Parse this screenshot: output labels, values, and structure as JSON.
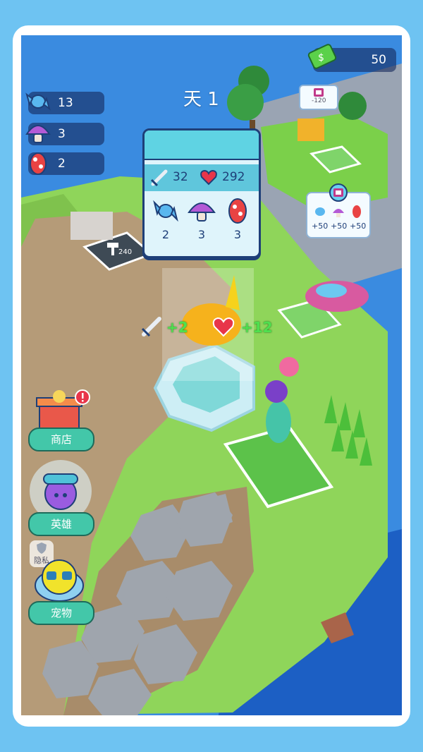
{
  "hud": {
    "money_value": "50",
    "resources": [
      {
        "name": "candy",
        "value": "13"
      },
      {
        "name": "mushroom",
        "value": "3"
      },
      {
        "name": "egg",
        "value": "2"
      }
    ],
    "day_label": "天 1"
  },
  "stats_card": {
    "attack": "32",
    "health": "292",
    "items": [
      {
        "name": "candy",
        "count": "2"
      },
      {
        "name": "mushroom",
        "count": "3"
      },
      {
        "name": "egg",
        "count": "3"
      }
    ]
  },
  "ad_bubble": {
    "rewards": [
      "+50",
      "+50",
      "+50"
    ]
  },
  "money_popup": "-120",
  "build_cost": "240",
  "floating": {
    "attack_gain": "+2",
    "health_gain": "+12"
  },
  "side_menu": {
    "shop": "商店",
    "hero": "英雄",
    "pet": "宠物",
    "privacy": "隐私"
  },
  "colors": {
    "frame_bg": "#6ec3f2",
    "card_border": "#1e3f78",
    "menu_green": "#43c7a9",
    "float_green": "#4fe04f"
  }
}
